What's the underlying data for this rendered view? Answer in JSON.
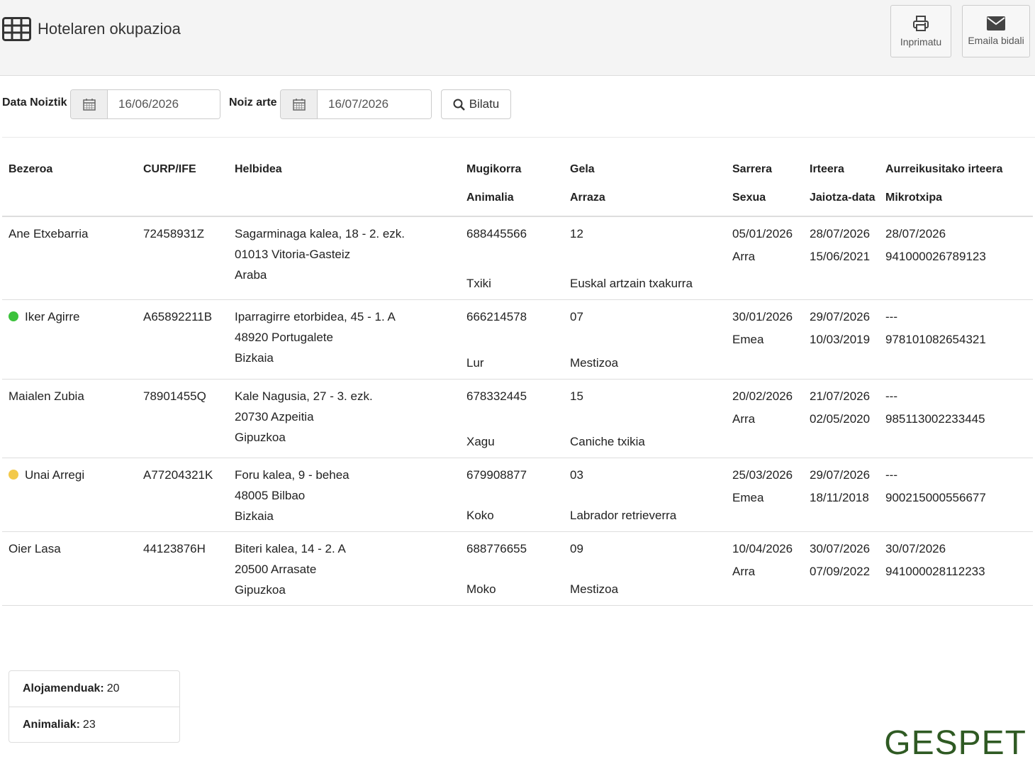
{
  "header": {
    "title": "Hotelaren okupazioa",
    "title_icon": "table-icon",
    "print_label": "Inprimatu",
    "email_label": "Emaila bidali"
  },
  "filters": {
    "from_label": "Data Noiztik",
    "from_value": "16/06/2026",
    "to_label": "Noiz arte",
    "to_value": "16/07/2026",
    "search_label": "Bilatu"
  },
  "table": {
    "headers_row1": [
      "Bezeroa",
      "CURP/IFE",
      "Helbidea",
      "Mugikorra",
      "Gela",
      "Sarrera",
      "Irteera",
      "Aurreikusitako irteera"
    ],
    "headers_row2": [
      "Animalia",
      "Arraza",
      "Sexua",
      "Jaiotza-data",
      "Mikrotxipa"
    ],
    "rows": [
      {
        "client": "Ane Etxebarria",
        "status": "",
        "curp": "72458931Z",
        "address": [
          "Sagarminaga kalea, 18 - 2. ezk.",
          "01013 Vitoria-Gasteiz",
          "Araba"
        ],
        "phone": "688445566",
        "room": "12",
        "checkin": "05/01/2026",
        "checkout": "28/07/2026",
        "expected_checkout": "28/07/2026",
        "animal": "Txiki",
        "breed": "Euskal artzain txakurra",
        "sex": "Arra",
        "birthdate": "15/06/2021",
        "microchip": "941000026789123"
      },
      {
        "client": "Iker Agirre",
        "status": "#3cc23c",
        "curp": "A65892211B",
        "address": [
          "Iparragirre etorbidea, 45 - 1. A",
          "48920 Portugalete",
          "Bizkaia"
        ],
        "phone": "666214578",
        "room": "07",
        "checkin": "30/01/2026",
        "checkout": "29/07/2026",
        "expected_checkout": "---",
        "animal": "Lur",
        "breed": "Mestizoa",
        "sex": "Emea",
        "birthdate": "10/03/2019",
        "microchip": "978101082654321"
      },
      {
        "client": "Maialen Zubia",
        "status": "",
        "curp": "78901455Q",
        "address": [
          "Kale Nagusia, 27 - 3. ezk.",
          "20730 Azpeitia",
          "Gipuzkoa"
        ],
        "phone": "678332445",
        "room": "15",
        "checkin": "20/02/2026",
        "checkout": "21/07/2026",
        "expected_checkout": "---",
        "animal": "Xagu",
        "breed": "Caniche txikia",
        "sex": "Arra",
        "birthdate": "02/05/2020",
        "microchip": "985113002233445"
      },
      {
        "client": "Unai Arregi",
        "status": "#f3c94a",
        "curp": "A77204321K",
        "address": [
          "Foru kalea, 9  - behea",
          "48005 Bilbao",
          "Bizkaia"
        ],
        "phone": "679908877",
        "room": "03",
        "checkin": "25/03/2026",
        "checkout": "29/07/2026",
        "expected_checkout": "---",
        "animal": "Koko",
        "breed": "Labrador retrieverra",
        "sex": "Emea",
        "birthdate": "18/11/2018",
        "microchip": "900215000556677"
      },
      {
        "client": "Oier Lasa",
        "status": "",
        "curp": "44123876H",
        "address": [
          "Biteri kalea, 14 - 2. A",
          "20500 Arrasate",
          "Gipuzkoa"
        ],
        "phone": "688776655",
        "room": "09",
        "checkin": "10/04/2026",
        "checkout": "30/07/2026",
        "expected_checkout": "30/07/2026",
        "animal": "Moko",
        "breed": "Mestizoa",
        "sex": "Arra",
        "birthdate": "07/09/2022",
        "microchip": "941000028112233"
      }
    ]
  },
  "summary": {
    "lodgings_label": "Alojamenduak:",
    "lodgings_value": "20",
    "animals_label": "Animaliak:",
    "animals_value": "23"
  },
  "brand": {
    "logo_text": "GESPET",
    "accent": "#4c7f1a"
  }
}
